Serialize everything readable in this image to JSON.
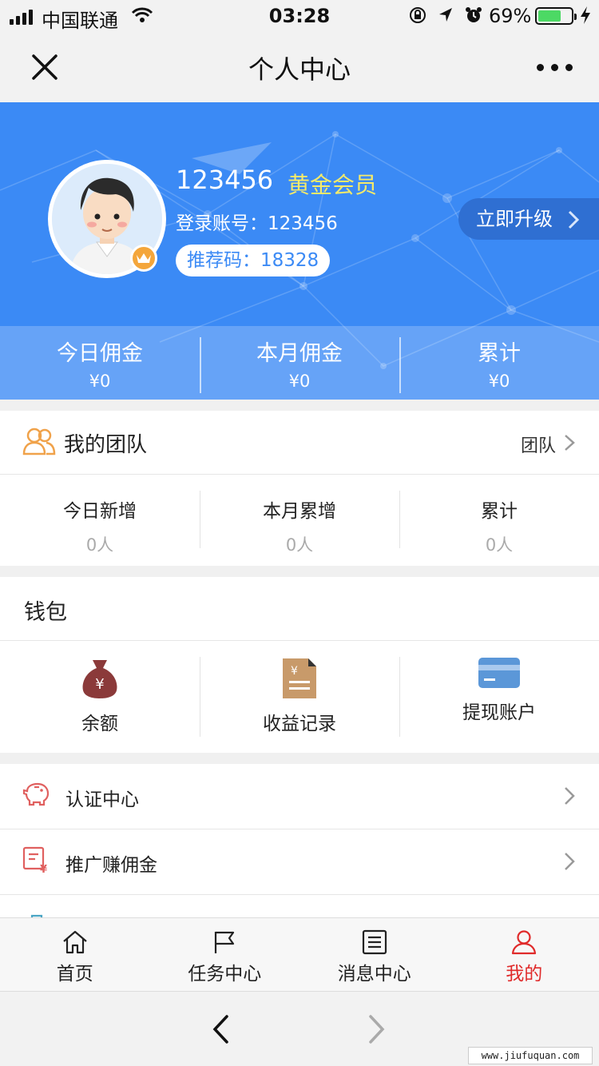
{
  "status_bar": {
    "carrier": "中国联通",
    "time": "03:28",
    "battery": "69%",
    "battery_level": 0.69
  },
  "nav": {
    "title": "个人中心",
    "close_icon": "close-icon",
    "more_icon": "more-icon"
  },
  "profile": {
    "username": "123456",
    "level": "黄金会员",
    "account": "登录账号：123456",
    "referral": "推荐码：18328",
    "upgrade": "立即升级",
    "colors": {
      "bg": "#3b8af5",
      "level": "#f5ea6a"
    }
  },
  "commission": [
    {
      "label": "今日佣金",
      "value": "¥0"
    },
    {
      "label": "本月佣金",
      "value": "¥0"
    },
    {
      "label": "累计",
      "value": "¥0"
    }
  ],
  "team": {
    "title": "我的团队",
    "link": "团队",
    "stats": [
      {
        "label": "今日新增",
        "value": "0人"
      },
      {
        "label": "本月累增",
        "value": "0人"
      },
      {
        "label": "累计",
        "value": "0人"
      }
    ]
  },
  "wallet": {
    "title": "钱包",
    "items": [
      {
        "label": "余额",
        "icon": "money-bag-icon"
      },
      {
        "label": "收益记录",
        "icon": "receipt-icon"
      },
      {
        "label": "提现账户",
        "icon": "bank-card-icon"
      }
    ]
  },
  "menu": [
    {
      "label": "认证中心",
      "icon": "piggy-bank-icon"
    },
    {
      "label": "推广赚佣金",
      "icon": "invoice-icon"
    },
    {
      "label": "",
      "icon": "bag-icon"
    }
  ],
  "tabbar": {
    "active": "我的",
    "active_color": "#e02b2b",
    "tabs": [
      {
        "label": "首页",
        "icon": "home-icon"
      },
      {
        "label": "任务中心",
        "icon": "flag-icon"
      },
      {
        "label": "消息中心",
        "icon": "list-icon"
      },
      {
        "label": "我的",
        "icon": "user-icon"
      }
    ]
  },
  "watermark": "www.jiufuquan.com"
}
